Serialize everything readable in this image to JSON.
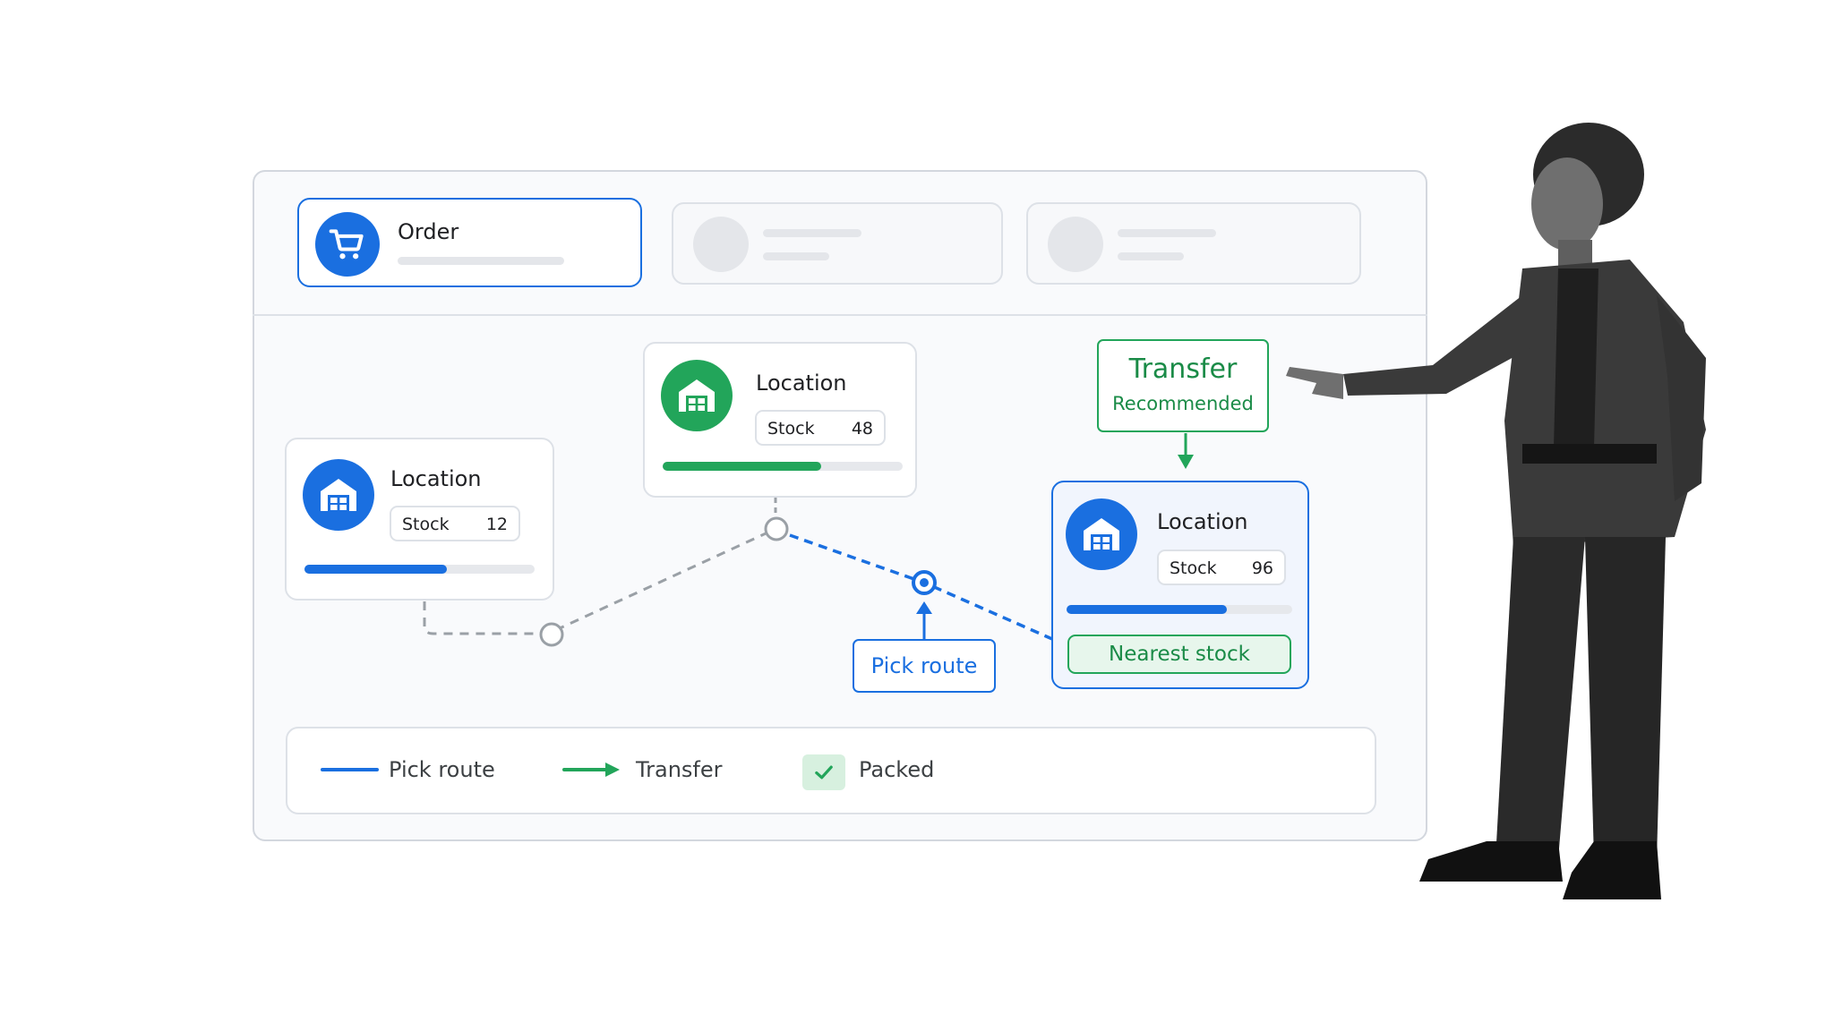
{
  "order_card": {
    "title": "Order",
    "icon": "cart-icon"
  },
  "locations": [
    {
      "title": "Location",
      "stock_label": "Stock",
      "stock_value": "12",
      "fill": 0.62,
      "color": "#1a6fe0",
      "icon": "warehouse-icon"
    },
    {
      "title": "Location",
      "stock_label": "Stock",
      "stock_value": "48",
      "fill": 0.66,
      "color": "#22a55a",
      "icon": "warehouse-icon"
    },
    {
      "title": "Location",
      "stock_label": "Stock",
      "stock_value": "96",
      "fill": 0.71,
      "color": "#1a6fe0",
      "icon": "warehouse-icon"
    }
  ],
  "callouts": {
    "pick_route": "Pick route",
    "transfer_title": "Transfer",
    "transfer_sub": "Recommended",
    "nearest": "Nearest stock"
  },
  "legend": {
    "pick_route": "Pick route",
    "transfer": "Transfer",
    "packed": "Packed"
  },
  "colors": {
    "accent_blue": "#1a6fe0",
    "accent_green": "#22a55a",
    "muted": "#9aa0a6"
  }
}
